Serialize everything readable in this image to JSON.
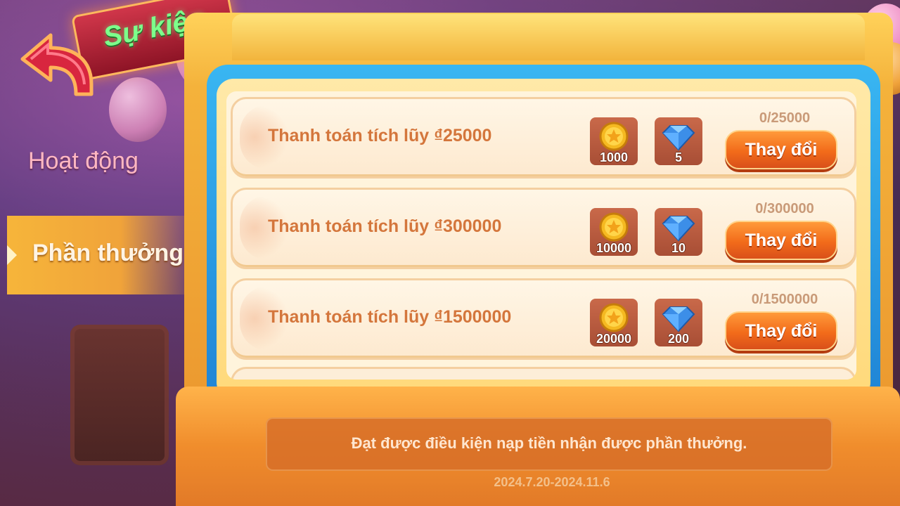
{
  "header": {
    "title": "Sự kiện"
  },
  "nav": {
    "activity_label": "Hoạt động",
    "reward_label": "Phần thưởng"
  },
  "rewards": [
    {
      "label": "Thanh toán tích lũy ₫25000",
      "coins": "1000",
      "gems": "5",
      "progress": "0/25000",
      "button_label": "Thay đổi"
    },
    {
      "label": "Thanh toán tích lũy ₫300000",
      "coins": "10000",
      "gems": "10",
      "progress": "0/300000",
      "button_label": "Thay đổi"
    },
    {
      "label": "Thanh toán tích lũy ₫1500000",
      "coins": "20000",
      "gems": "200",
      "progress": "0/1500000",
      "button_label": "Thay đổi"
    }
  ],
  "footer": {
    "notice": "Đạt được điều kiện nạp tiền nhận được phần thưởng.",
    "date_range": "2024.7.20-2024.11.6"
  },
  "colors": {
    "title_text": "#7dff8b",
    "row_label": "#d4763c",
    "button": "#f26b1a",
    "frame_blue": "#39b6f2",
    "frame_gold": "#f4b23b"
  },
  "icons": [
    "back-arrow-icon",
    "coin-icon",
    "diamond-icon"
  ]
}
